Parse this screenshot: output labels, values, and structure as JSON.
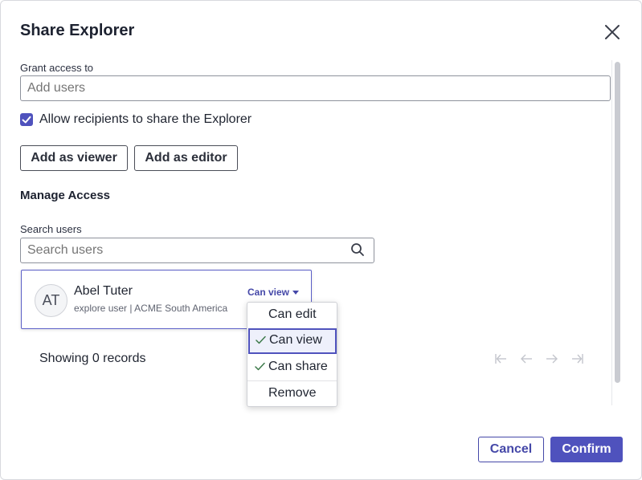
{
  "dialog": {
    "title": "Share Explorer",
    "close_icon": "close-icon"
  },
  "grant": {
    "label": "Grant access to",
    "placeholder": "Add users",
    "value": ""
  },
  "allow_share": {
    "label": "Allow recipients to share the Explorer",
    "checked": true
  },
  "actions": {
    "add_viewer": "Add as viewer",
    "add_editor": "Add as editor"
  },
  "manage": {
    "title": "Manage Access",
    "search_label": "Search users",
    "search_placeholder": "Search users",
    "search_icon": "search-icon"
  },
  "users": [
    {
      "initials": "AT",
      "name": "Abel Tuter",
      "subtitle": "explore user | ACME South America",
      "role": "Can view"
    }
  ],
  "role_menu": {
    "items": [
      {
        "label": "Can edit",
        "checked": false,
        "selected": false
      },
      {
        "label": "Can view",
        "checked": true,
        "selected": true
      },
      {
        "label": "Can share",
        "checked": true,
        "selected": false
      },
      {
        "label": "Remove",
        "checked": false,
        "selected": false
      }
    ]
  },
  "pagination": {
    "records_text": "Showing 0 records",
    "icons": [
      "first-page-icon",
      "prev-page-icon",
      "next-page-icon",
      "last-page-icon"
    ]
  },
  "footer": {
    "cancel": "Cancel",
    "confirm": "Confirm"
  },
  "colors": {
    "accent": "#4f52bd",
    "accent_text": "#4548a8",
    "border": "#8e929c",
    "disabled_icon": "#c3c5cc"
  }
}
